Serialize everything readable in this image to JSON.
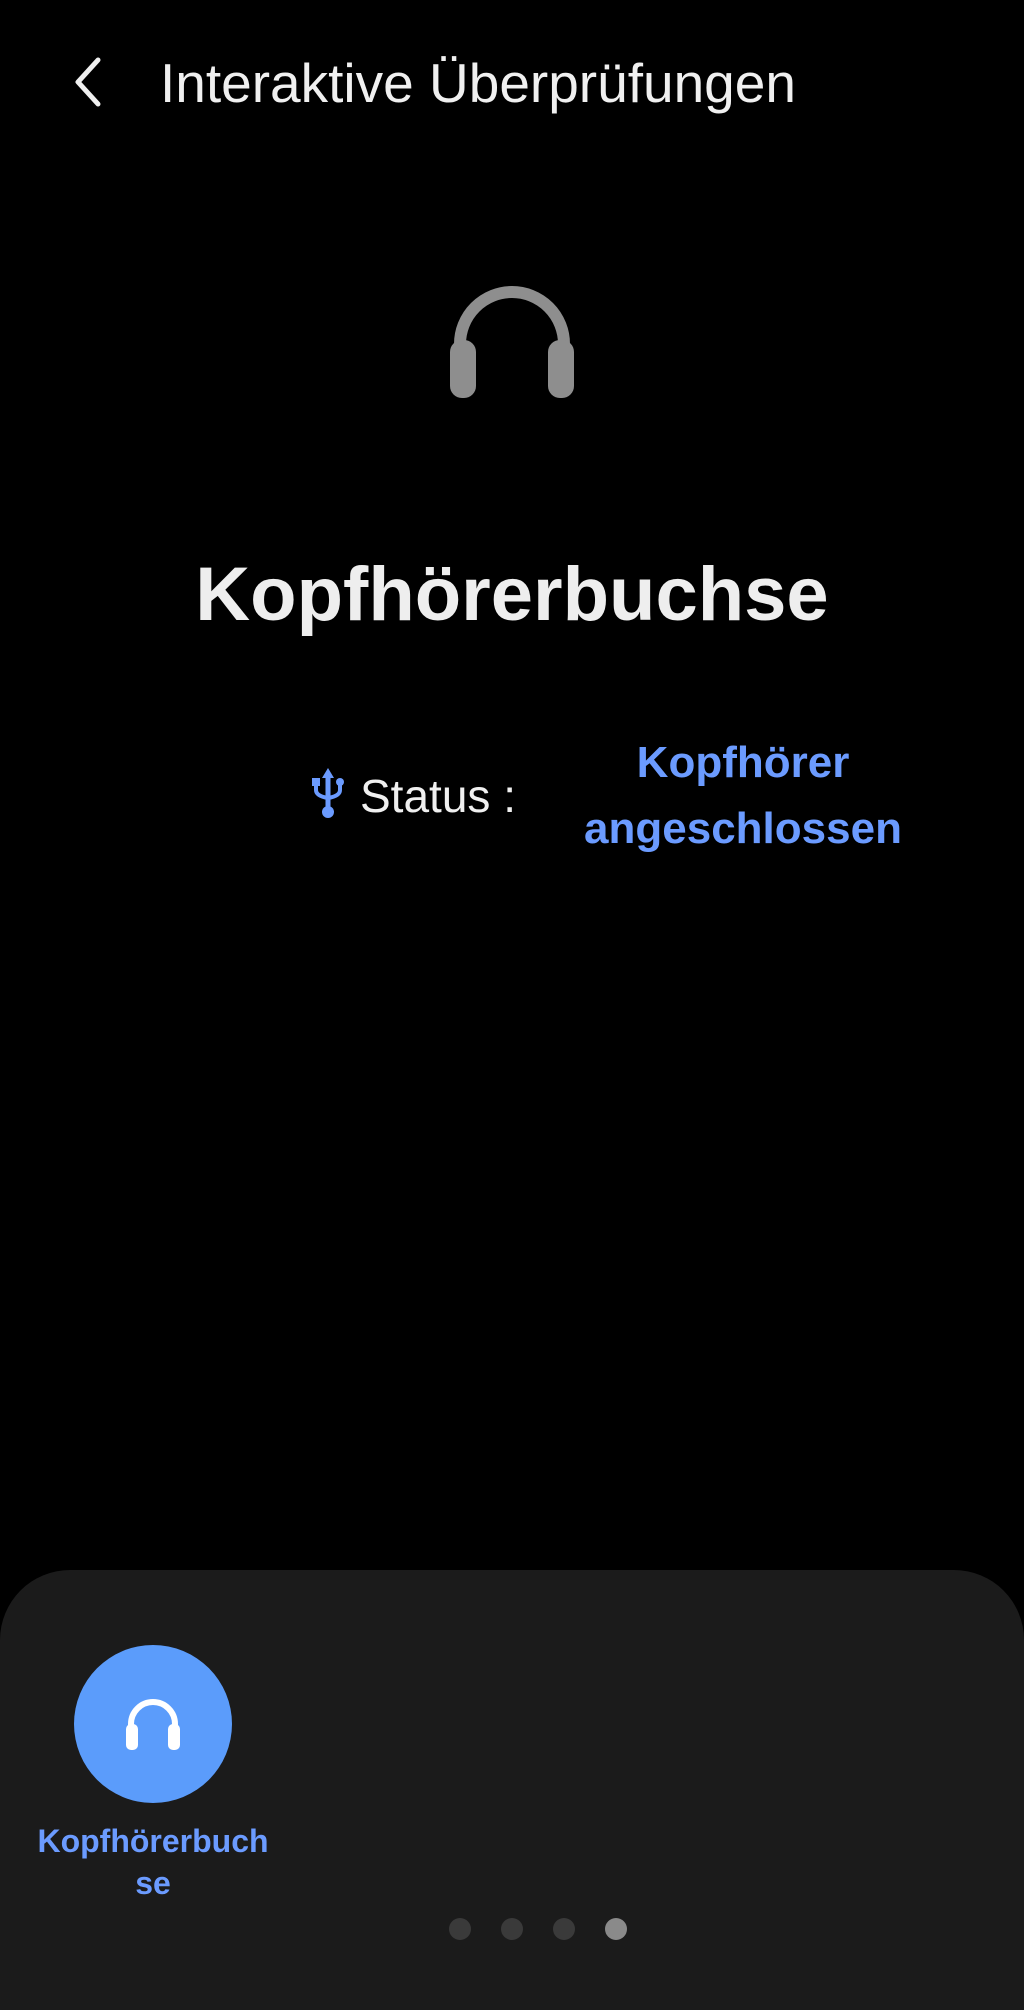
{
  "header": {
    "title": "Interaktive Überprüfungen",
    "back_icon": "chevron-left-icon"
  },
  "main": {
    "hero_icon": "headphones-icon",
    "test_title": "Kopfhörerbuchse",
    "status": {
      "icon": "usb-icon",
      "label": "Status :",
      "value_line1": "Kopfhörer",
      "value_line2": "angeschlossen",
      "value_color": "#6b9bff"
    }
  },
  "bottom_panel": {
    "items": [
      {
        "icon": "headphones-icon",
        "label_line1": "Kopfhörerbuch",
        "label_line2": "se",
        "accent": "#5b9cfb"
      }
    ],
    "pager": {
      "page_count": 4,
      "active_page": 4
    }
  },
  "colors": {
    "background": "#000000",
    "panel": "#1b1b1b",
    "accent": "#6b9bff",
    "icon_gray": "#8e8e8e"
  }
}
